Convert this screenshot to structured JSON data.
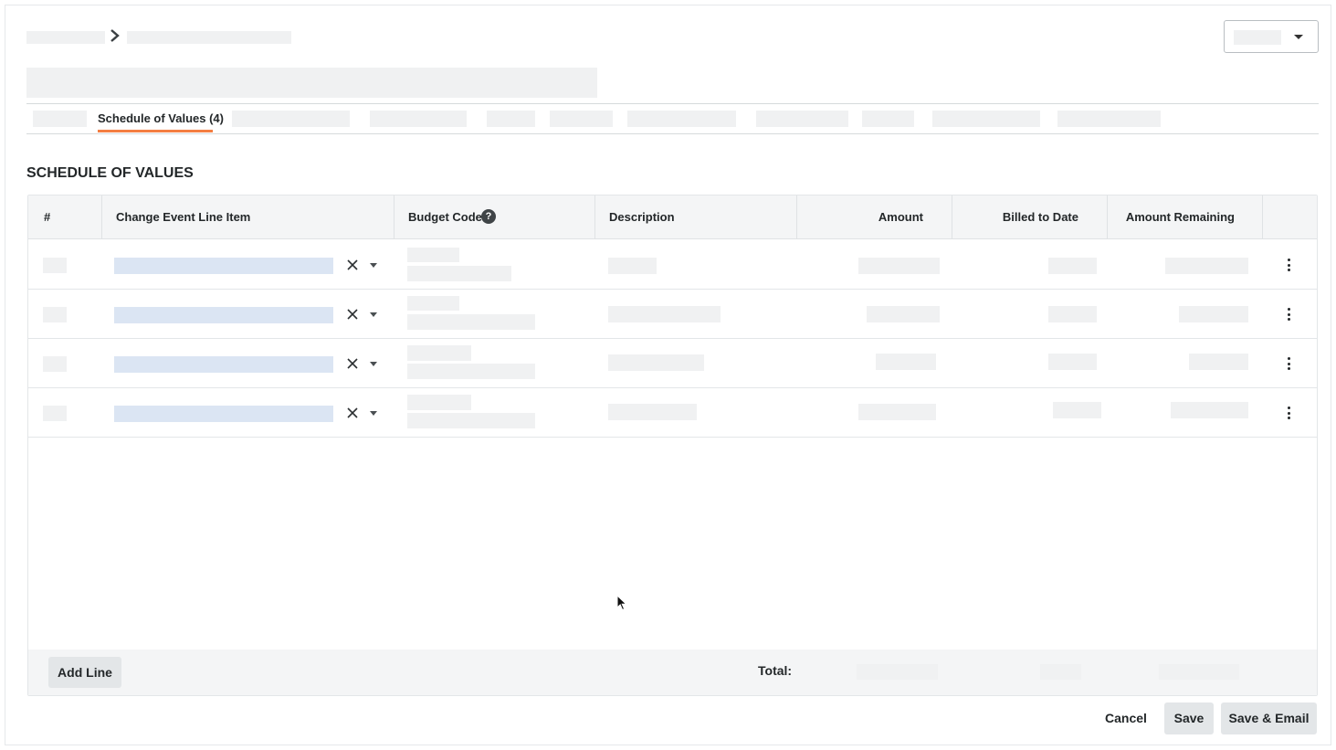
{
  "tabs": {
    "active_label": "Schedule of Values (4)"
  },
  "section": {
    "title": "SCHEDULE OF VALUES"
  },
  "table": {
    "columns": [
      "#",
      "Change Event Line Item",
      "Budget Code",
      "Description",
      "Amount",
      "Billed to Date",
      "Amount Remaining"
    ],
    "help_icon_glyph": "?",
    "row_count": 4
  },
  "footer": {
    "add_line_label": "Add Line",
    "total_label": "Total:"
  },
  "actions": {
    "cancel_label": "Cancel",
    "save_label": "Save",
    "save_email_label": "Save & Email"
  },
  "colors": {
    "accent": "#f47e42",
    "skeleton": "#f0f1f2",
    "skeleton_selected": "#dbe5f3"
  }
}
